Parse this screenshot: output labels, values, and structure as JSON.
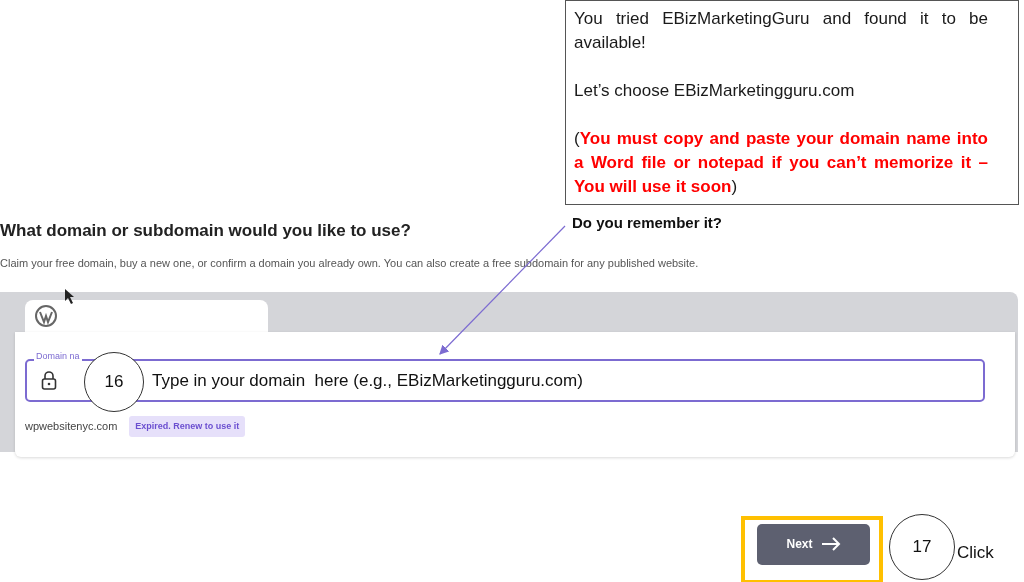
{
  "callout": {
    "paragraphs": [
      {
        "segments": [
          {
            "kind": "plain",
            "text": "You tried EBizMarketingGuru and found it to be available!"
          }
        ]
      },
      {
        "segments": [
          {
            "kind": "plain",
            "text": "Let’s choose EBizMarketingguru.com"
          }
        ]
      },
      {
        "segments": [
          {
            "kind": "plain",
            "text": "("
          },
          {
            "kind": "alert",
            "text": "You must copy and paste your domain name into a Word file or notepad if you can’t memorize it – You will use it soon"
          },
          {
            "kind": "plain",
            "text": ")"
          }
        ]
      }
    ]
  },
  "page": {
    "heading": "What domain or subdomain would you like to use?",
    "subheading": "Claim your free domain, buy a new one, or confirm a domain you already own. You can also create a free subdomain for any published website.",
    "domain_field": {
      "label": "Domain na"
    },
    "suggestions": [
      {
        "domain": "wpwebsitenyc.com",
        "badge": "Expired. Renew to use it"
      }
    ],
    "next_button": {
      "label": "Next"
    }
  },
  "annotations": {
    "question": "Do you remember it?",
    "steps": [
      {
        "number": "16",
        "text": "Type in your domain  here (e.g., EBizMarketingguru.com)"
      },
      {
        "number": "17",
        "text": "Click"
      }
    ]
  }
}
